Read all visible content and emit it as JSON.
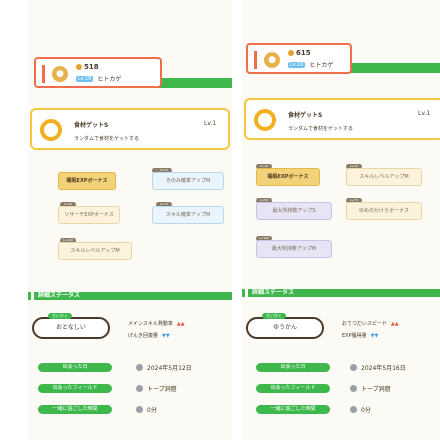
{
  "panels": [
    {
      "header": {
        "count": "518",
        "level_badge": "Lv.16",
        "name": "ヒトカゲ"
      },
      "ingredient": {
        "title": "食材ゲットS",
        "subtitle": "ランダムで食材をゲットする",
        "level": "Lv.1"
      },
      "tiles": [
        {
          "label": "睡眠EXPボーナス",
          "tag": "Lv.10",
          "style": "gold"
        },
        {
          "label": "きのみ確率アップM",
          "tag": "Lv.25",
          "style": "blue"
        },
        {
          "label": "リサーチEXPボーナス",
          "tag": "Lv.50",
          "style": "cream"
        },
        {
          "label": "スキル確率アップM",
          "tag": "Lv.75",
          "style": "blue"
        },
        {
          "label": "スキルレベルアップM",
          "tag": "Lv.100",
          "style": "cream"
        }
      ],
      "section_title": "詳細ステータス",
      "nature": {
        "tag": "せいかく",
        "value": "おとなしい"
      },
      "stats": [
        {
          "label": "メインスキル発動率",
          "mark": "▲▲",
          "dir": "up"
        },
        {
          "label": "げんき回復量",
          "mark": "▼▼",
          "dir": "down"
        }
      ],
      "info": [
        {
          "pill": "出会った日",
          "value": "2024年5月12日"
        },
        {
          "pill": "出会ったフィールド",
          "value": "トープ洞窟"
        },
        {
          "pill": "一緒に過ごした時間",
          "value": "0分"
        }
      ]
    },
    {
      "header": {
        "count": "615",
        "level_badge": "Lv.16",
        "name": "ヒトカゲ"
      },
      "ingredient": {
        "title": "食材ゲットS",
        "subtitle": "ランダムで食材をゲットする",
        "level": "Lv.1"
      },
      "tiles": [
        {
          "label": "睡眠EXPボーナス",
          "tag": "Lv.10",
          "style": "gold"
        },
        {
          "label": "スキルレベルアップM",
          "tag": "Lv.25",
          "style": "cream"
        },
        {
          "label": "最大所持数アップS",
          "tag": "Lv.50",
          "style": "lav"
        },
        {
          "label": "ゆめのかけらボーナス",
          "tag": "Lv.75",
          "style": "cream"
        },
        {
          "label": "最大所持数アップM",
          "tag": "Lv.100",
          "style": "lav"
        }
      ],
      "section_title": "詳細ステータス",
      "nature": {
        "tag": "せいかく",
        "value": "ゆうかん"
      },
      "stats": [
        {
          "label": "おてつだいスピード",
          "mark": "▲▲",
          "dir": "up"
        },
        {
          "label": "EXP獲得量",
          "mark": "▼▼",
          "dir": "down"
        }
      ],
      "info": [
        {
          "pill": "出会った日",
          "value": "2024年5月16日"
        },
        {
          "pill": "出会ったフィールド",
          "value": "トープ洞窟"
        },
        {
          "pill": "一緒に過ごした時間",
          "value": "0分"
        }
      ]
    }
  ]
}
